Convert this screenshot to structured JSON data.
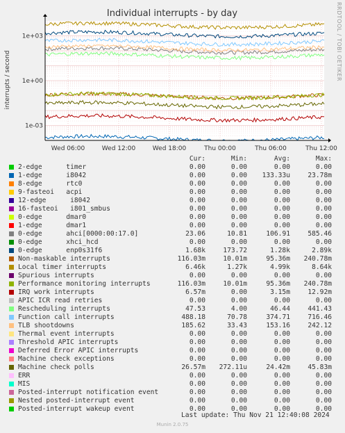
{
  "chart_data": {
    "type": "line",
    "title": "Individual interrupts - by day",
    "ylabel": "interrupts / second",
    "yscale": "log",
    "ylim": [
      0.0001,
      10000
    ],
    "y_ticks": [
      {
        "value": 1000,
        "label": "1e+03"
      },
      {
        "value": 1,
        "label": "1e+00"
      },
      {
        "value": 0.001,
        "label": "1e-03"
      }
    ],
    "x_ticks": [
      "Wed 06:00",
      "Wed 12:00",
      "Wed 18:00",
      "Thu 00:00",
      "Thu 06:00",
      "Thu 12:00"
    ],
    "side_label": "RRDTOOL / TOBI OETIKER",
    "grid": true,
    "columns": [
      "Cur:",
      "Min:",
      "Avg:",
      "Max:"
    ],
    "series": [
      {
        "name": "2-edge      timer",
        "color": "#00cc00",
        "cur": "0.00",
        "min": "0.00",
        "avg": "0.00",
        "max": "0.00"
      },
      {
        "name": "1-edge      i8042",
        "color": "#0066b3",
        "cur": "0.00",
        "min": "0.00",
        "avg": "133.33u",
        "max": "23.78m"
      },
      {
        "name": "8-edge      rtc0",
        "color": "#ff8000",
        "cur": "0.00",
        "min": "0.00",
        "avg": "0.00",
        "max": "0.00"
      },
      {
        "name": "9-fasteoi   acpi",
        "color": "#ffcc00",
        "cur": "0.00",
        "min": "0.00",
        "avg": "0.00",
        "max": "0.00"
      },
      {
        "name": "12-edge      i8042",
        "color": "#330099",
        "cur": "0.00",
        "min": "0.00",
        "avg": "0.00",
        "max": "0.00"
      },
      {
        "name": "16-fasteoi   i801_smbus",
        "color": "#990099",
        "cur": "0.00",
        "min": "0.00",
        "avg": "0.00",
        "max": "0.00"
      },
      {
        "name": "0-edge      dmar0",
        "color": "#ccff00",
        "cur": "0.00",
        "min": "0.00",
        "avg": "0.00",
        "max": "0.00"
      },
      {
        "name": "1-edge      dmar1",
        "color": "#ff0000",
        "cur": "0.00",
        "min": "0.00",
        "avg": "0.00",
        "max": "0.00"
      },
      {
        "name": "0-edge      ahci[0000:00:17.0]",
        "color": "#808080",
        "cur": "23.06",
        "min": "10.81",
        "avg": "106.91",
        "max": "585.46"
      },
      {
        "name": "0-edge      xhci_hcd",
        "color": "#008f00",
        "cur": "0.00",
        "min": "0.00",
        "avg": "0.00",
        "max": "0.00"
      },
      {
        "name": "0-edge      enp0s31f6",
        "color": "#00487d",
        "cur": "1.68k",
        "min": "173.72",
        "avg": "1.28k",
        "max": "2.89k"
      },
      {
        "name": "Non-maskable interrupts",
        "color": "#b35a00",
        "cur": "116.03m",
        "min": "10.01m",
        "avg": "95.36m",
        "max": "240.78m"
      },
      {
        "name": "Local timer interrupts",
        "color": "#b38f00",
        "cur": "6.46k",
        "min": "1.27k",
        "avg": "4.99k",
        "max": "8.64k"
      },
      {
        "name": "Spurious interrupts",
        "color": "#6b006b",
        "cur": "0.00",
        "min": "0.00",
        "avg": "0.00",
        "max": "0.00"
      },
      {
        "name": "Performance monitoring interrupts",
        "color": "#8fb300",
        "cur": "116.03m",
        "min": "10.01m",
        "avg": "95.36m",
        "max": "240.78m"
      },
      {
        "name": "IRQ work interrupts",
        "color": "#b30000",
        "cur": "6.57m",
        "min": "0.00",
        "avg": "3.15m",
        "max": "12.92m"
      },
      {
        "name": "APIC ICR read retries",
        "color": "#bebebe",
        "cur": "0.00",
        "min": "0.00",
        "avg": "0.00",
        "max": "0.00"
      },
      {
        "name": "Rescheduling interrupts",
        "color": "#80ff80",
        "cur": "47.53",
        "min": "4.00",
        "avg": "46.44",
        "max": "441.43"
      },
      {
        "name": "Function call interrupts",
        "color": "#80c9ff",
        "cur": "488.18",
        "min": "70.78",
        "avg": "374.71",
        "max": "716.46"
      },
      {
        "name": "TLB shootdowns",
        "color": "#ffc080",
        "cur": "185.62",
        "min": "33.43",
        "avg": "153.16",
        "max": "242.12"
      },
      {
        "name": "Thermal event interrupts",
        "color": "#ffe680",
        "cur": "0.00",
        "min": "0.00",
        "avg": "0.00",
        "max": "0.00"
      },
      {
        "name": "Threshold APIC interrupts",
        "color": "#aa80ff",
        "cur": "0.00",
        "min": "0.00",
        "avg": "0.00",
        "max": "0.00"
      },
      {
        "name": "Deferred Error APIC interrupts",
        "color": "#ee00cc",
        "cur": "0.00",
        "min": "0.00",
        "avg": "0.00",
        "max": "0.00"
      },
      {
        "name": "Machine check exceptions",
        "color": "#ff8080",
        "cur": "0.00",
        "min": "0.00",
        "avg": "0.00",
        "max": "0.00"
      },
      {
        "name": "Machine check polls",
        "color": "#666600",
        "cur": "26.57m",
        "min": "272.11u",
        "avg": "24.42m",
        "max": "45.83m"
      },
      {
        "name": "ERR",
        "color": "#ffbfff",
        "cur": "0.00",
        "min": "0.00",
        "avg": "0.00",
        "max": "0.00"
      },
      {
        "name": "MIS",
        "color": "#00ffcc",
        "cur": "0.00",
        "min": "0.00",
        "avg": "0.00",
        "max": "0.00"
      },
      {
        "name": "Posted-interrupt notification event",
        "color": "#cc6699",
        "cur": "0.00",
        "min": "0.00",
        "avg": "0.00",
        "max": "0.00"
      },
      {
        "name": "Nested posted-interrupt event",
        "color": "#999900",
        "cur": "0.00",
        "min": "0.00",
        "avg": "0.00",
        "max": "0.00"
      },
      {
        "name": "Posted-interrupt wakeup event",
        "color": "#00cc00",
        "cur": "0.00",
        "min": "0.00",
        "avg": "0.00",
        "max": "0.00"
      }
    ]
  },
  "footer": {
    "last_update": "Last update: Thu Nov 21 12:40:08 2024",
    "munin": "Munin 2.0.75"
  }
}
